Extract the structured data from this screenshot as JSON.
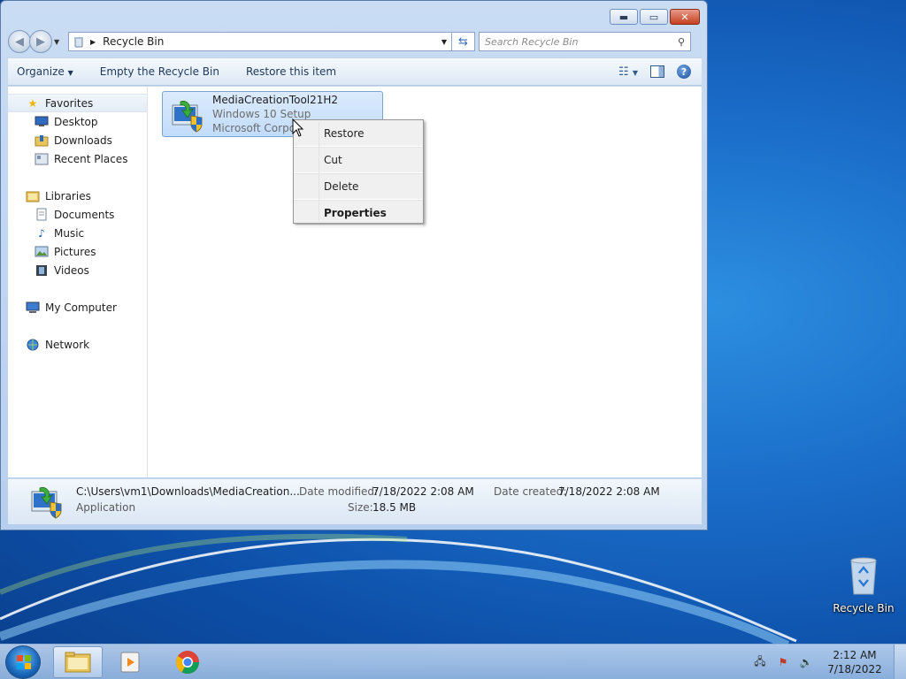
{
  "window": {
    "controls": {
      "minimize": "▬",
      "maximize": "▭",
      "close": "✕"
    }
  },
  "navbar": {
    "back_glyph": "◀",
    "forward_glyph": "▶",
    "breadcrumb": "Recycle Bin",
    "search_placeholder": "Search Recycle Bin"
  },
  "toolbar": {
    "organize": "Organize",
    "empty_recycle_bin": "Empty the Recycle Bin",
    "restore_item": "Restore this item"
  },
  "sidebar": {
    "favorites": "Favorites",
    "desktop": "Desktop",
    "downloads": "Downloads",
    "recent_places": "Recent Places",
    "libraries": "Libraries",
    "documents": "Documents",
    "music": "Music",
    "pictures": "Pictures",
    "videos": "Videos",
    "my_computer": "My Computer",
    "network": "Network"
  },
  "file": {
    "name": "MediaCreationTool21H2",
    "type": "Windows 10 Setup",
    "company": "Microsoft Corporation"
  },
  "context_menu": {
    "restore": "Restore",
    "cut": "Cut",
    "delete": "Delete",
    "properties": "Properties"
  },
  "details": {
    "path": "C:\\Users\\vm1\\Downloads\\MediaCreation...",
    "type": "Application",
    "date_modified_label": "Date modified:",
    "date_modified": "7/18/2022 2:08 AM",
    "date_created_label": "Date created:",
    "date_created": "7/18/2022 2:08 AM",
    "size_label": "Size:",
    "size": "18.5 MB"
  },
  "desktop": {
    "recycle_bin_label": "Recycle Bin"
  },
  "taskbar": {
    "time": "2:12 AM",
    "date": "7/18/2022"
  },
  "colors": {
    "desktop_blue": "#1a6dc9",
    "selection": "#c1dcfc",
    "window_frame": "#b7cfee"
  }
}
